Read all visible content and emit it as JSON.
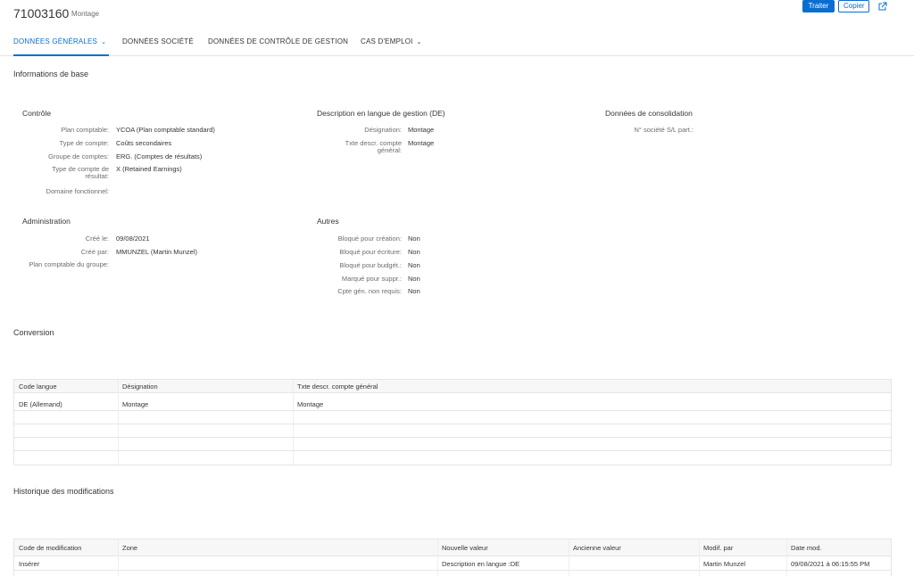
{
  "header": {
    "title": "71003160",
    "subtitle": "Montage",
    "edit_label": "Traiter",
    "copy_label": "Copier",
    "share_icon": "share-icon"
  },
  "tabs": [
    {
      "label": "DONNÉES GÉNÉRALES",
      "active": true
    },
    {
      "label": "DONNÉES SOCIÉTÉ"
    },
    {
      "label": "DONNÉES DE CONTRÔLE DE GESTION"
    },
    {
      "label": "CAS D'EMPLOI"
    }
  ],
  "basic_info": {
    "title": "Informations de base",
    "controle": {
      "title": "Contrôle",
      "fields": [
        {
          "label": "Plan comptable:",
          "value": "YCOA (Plan comptable standard)"
        },
        {
          "label": "Type de compte:",
          "value": "Coûts secondaires"
        },
        {
          "label": "Groupe de comptes:",
          "value": "ERG. (Comptes de résultats)"
        },
        {
          "label": "Type de compte de résultat:",
          "value": "X (Retained Earnings)"
        },
        {
          "label": "Domaine fonctionnel:",
          "value": ""
        }
      ]
    },
    "description": {
      "title": "Description en langue de gestion (DE)",
      "fields": [
        {
          "label": "Désignation:",
          "value": "Montage"
        },
        {
          "label": "Txte descr. compte général:",
          "value": "Montage"
        }
      ]
    },
    "consolidation": {
      "title": "Données de consolidation",
      "fields": [
        {
          "label": "N° société S/L part.:",
          "value": ""
        }
      ]
    },
    "administration": {
      "title": "Administration",
      "fields": [
        {
          "label": "Créé le:",
          "value": "09/08/2021"
        },
        {
          "label": "Créé par:",
          "value": "MMUNZEL (Martin Munzel)"
        },
        {
          "label": "Plan comptable du groupe:",
          "value": ""
        }
      ]
    },
    "autres": {
      "title": "Autres",
      "fields": [
        {
          "label": "Bloqué pour création:",
          "value": "Non"
        },
        {
          "label": "Bloqué pour écriture:",
          "value": "Non"
        },
        {
          "label": "Bloqué pour budgét.:",
          "value": "Non"
        },
        {
          "label": "Marqué pour suppr.:",
          "value": "Non"
        },
        {
          "label": "Cpte gén. non requis:",
          "value": "Non"
        }
      ]
    }
  },
  "conversion": {
    "title": "Conversion",
    "columns": [
      "Code langue",
      "Désignation",
      "Txte descr. compte général"
    ],
    "rows": [
      [
        "DE (Allemand)",
        "Montage",
        "Montage"
      ],
      [
        "",
        "",
        ""
      ],
      [
        "",
        "",
        ""
      ],
      [
        "",
        "",
        ""
      ]
    ]
  },
  "history": {
    "title": "Historique des modifications",
    "columns": [
      "Code de modification",
      "Zone",
      "Nouvelle valeur",
      "Ancienne valeur",
      "Modif. par",
      "Date mod."
    ],
    "rows": [
      [
        "Insérer",
        "",
        "Description en langue :DE",
        "",
        "Martin Munzel",
        "09/08/2021 à 06:15:55 PM"
      ]
    ]
  }
}
